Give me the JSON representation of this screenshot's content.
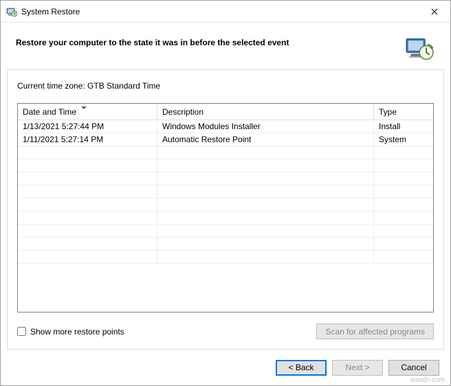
{
  "window": {
    "title": "System Restore"
  },
  "header": {
    "heading": "Restore your computer to the state it was in before the selected event"
  },
  "content": {
    "timezone_label": "Current time zone: GTB Standard Time",
    "columns": {
      "date": "Date and Time",
      "description": "Description",
      "type": "Type"
    },
    "rows": [
      {
        "date": "1/13/2021 5:27:44 PM",
        "description": "Windows Modules Installer",
        "type": "Install"
      },
      {
        "date": "1/11/2021 5:27:14 PM",
        "description": "Automatic Restore Point",
        "type": "System"
      }
    ],
    "show_more_label": "Show more restore points",
    "scan_label": "Scan for affected programs"
  },
  "footer": {
    "back": "< Back",
    "next": "Next >",
    "cancel": "Cancel"
  },
  "watermark": "wsxdn.com"
}
